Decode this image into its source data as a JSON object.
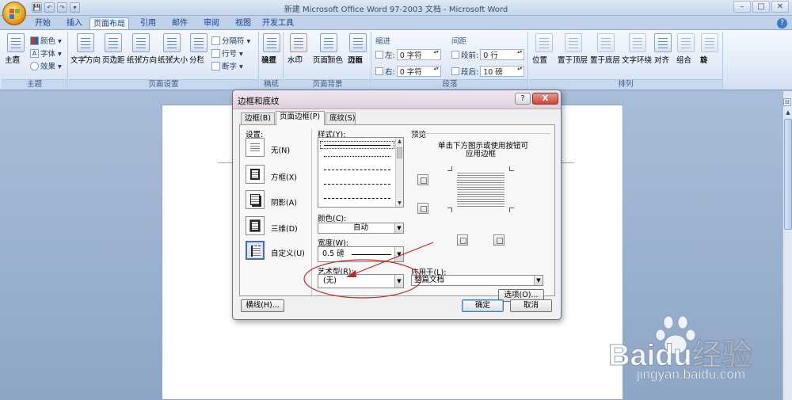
{
  "window": {
    "title": "新建 Microsoft Office Word 97-2003 文档 - Microsoft Word",
    "controls": [
      "–",
      "□",
      "✕"
    ]
  },
  "quick_access": [
    "💾",
    "↶",
    "↷",
    "▾"
  ],
  "tabs": [
    "开始",
    "插入",
    "页面布局",
    "引用",
    "邮件",
    "审阅",
    "视图",
    "开发工具"
  ],
  "active_tab": "页面布局",
  "ribbon": {
    "theme": {
      "big": "主题",
      "colors": "颜色 ▾",
      "fonts": "字体 ▾",
      "effects": "效果 ▾",
      "label": "主题"
    },
    "page_setup": {
      "text_direction": "文字方向",
      "margins": "页边距",
      "orientation": "纸张方向",
      "size": "纸张大小",
      "columns": "分栏",
      "breaks": "分隔符 ▾",
      "line_numbers": "行号 ▾",
      "hyphenation": "断字 ▾",
      "label": "页面设置"
    },
    "manuscript": {
      "btn": "稿纸\n设置",
      "btn_l1": "稿纸",
      "btn_l2": "设置",
      "label": "稿纸"
    },
    "page_background": {
      "watermark": "水印",
      "page_color": "页面颜色",
      "page_border_l1": "页面",
      "page_border_l2": "边框",
      "label": "页面背景"
    },
    "paragraph": {
      "indent_title": "缩进",
      "left": "左:",
      "left_value": "0 字符",
      "right": "右:",
      "right_value": "0 字符",
      "spacing_title": "间距",
      "before": "段前:",
      "before_value": "0 行",
      "after": "段后:",
      "after_value": "10 磅",
      "label": "段落"
    },
    "arrange": {
      "position": "位置",
      "bring_front": "置于顶层",
      "send_back": "置于底层",
      "wrap": "文字环绕",
      "align": "对齐",
      "group": "组合",
      "rotate": "旋\n转",
      "rotate_l1": "旋",
      "rotate_l2": "转",
      "label": "排列"
    }
  },
  "dialog": {
    "title": "边框和底纹",
    "help": "?",
    "close": "X",
    "tabs": [
      "边框(B)",
      "页面边框(P)",
      "底纹(S)"
    ],
    "active_tab": "页面边框(P)",
    "settings_label": "设置:",
    "settings": [
      "无(N)",
      "方框(X)",
      "阴影(A)",
      "三维(D)",
      "自定义(U)"
    ],
    "selected_setting": "自定义(U)",
    "style_label": "样式(Y):",
    "color_label": "颜色(C):",
    "color_value": "自动",
    "width_label": "宽度(W):",
    "width_value": "0.5 磅",
    "art_label": "艺术型(R):",
    "art_value": "(无)",
    "preview_label": "预览",
    "preview_hint_1": "单击下方图示或使用按钮可",
    "preview_hint_2": "应用边框",
    "apply_to_label": "应用于(L):",
    "apply_to_value": "整篇文档",
    "options_btn": "选项(O)...",
    "horizontal_line_btn": "横线(H)...",
    "ok_btn": "确定",
    "cancel_btn": "取消"
  },
  "annotation": {
    "color": "#c0282a"
  },
  "watermark": {
    "brand": "Baidu经验",
    "url": "jingyan.baidu.com"
  }
}
